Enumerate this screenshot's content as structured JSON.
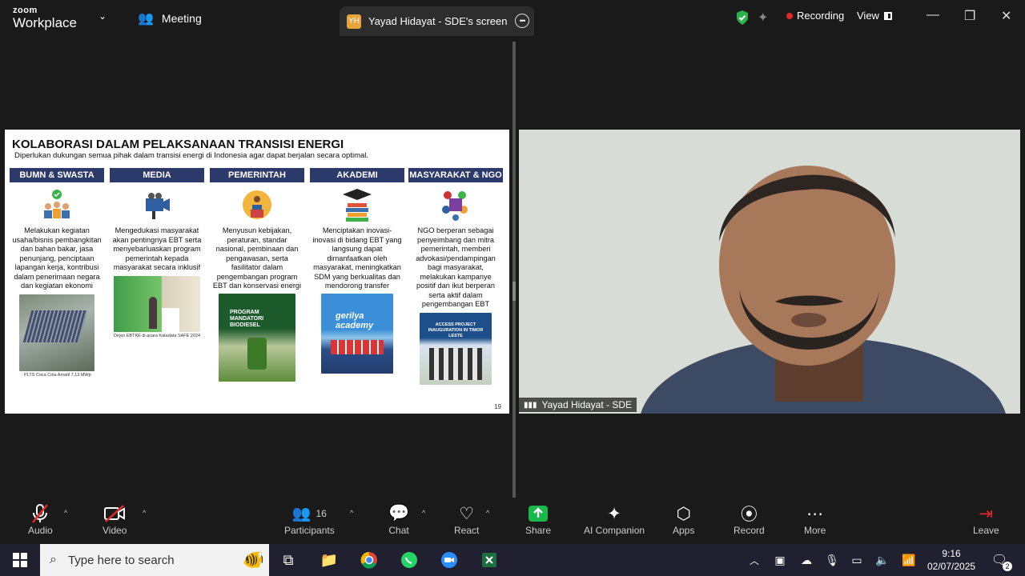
{
  "app": {
    "logo_top": "zoom",
    "logo_bottom": "Workplace",
    "meeting_label": "Meeting"
  },
  "share_tab": {
    "initials": "YH",
    "label": "Yayad Hidayat - SDE's screen"
  },
  "top_right": {
    "recording": "Recording",
    "view": "View"
  },
  "slide": {
    "title": "KOLABORASI DALAM PELAKSANAAN TRANSISI ENERGI",
    "subtitle": "Diperlukan dukungan semua pihak dalam transisi energi di Indonesia agar dapat berjalan secara optimal.",
    "page": "19",
    "columns": [
      {
        "head": "BUMN & SWASTA",
        "icon": "people-check-icon",
        "text": "Melakukan kegiatan usaha/bisnis pembangkitan dan bahan bakar, jasa penunjang, penciptaan lapangan kerja, kontribusi dalam penerimaan negara dan kegiatan ekonomi",
        "caption": "PLTS Coca Cola Amatil 7,13 MWp"
      },
      {
        "head": "MEDIA",
        "icon": "camera-icon",
        "text": "Mengedukasi masyarakat akan pentingnya EBT serta menyebarluaskan program pemerintah kepada masyarakat secara inklusif",
        "caption": "Dirjen EBTKE di acara Katadata SAFE 2024"
      },
      {
        "head": "PEMERINTAH",
        "icon": "podium-icon",
        "text": "Menyusun kebijakan, peraturan, standar nasional, pembinaan dan pengawasan, serta fasilitator dalam pengembangan program EBT dan konservasi energi",
        "caption": "",
        "img_text": "PROGRAM MANDATORI BIODIESEL"
      },
      {
        "head": "AKADEMI",
        "icon": "graduation-icon",
        "text": "Menciptakan inovasi-inovasi di bidang EBT yang langsung dapat dimanfaatkan oleh masyarakat, meningkatkan SDM yang berkualitas dan mendorong transfer",
        "caption": "",
        "img_text": "gerilya academy"
      },
      {
        "head": "MASYARAKAT & NGO",
        "icon": "puzzle-icon",
        "text": "NGO berperan sebagai penyeimbang dan mitra pemerintah, memberi advokasi/pendampingan bagi masyarakat, melakukan kampanye positif dan ikut berperan serta aktif dalam pengembangan EBT",
        "caption": "",
        "img_text": "ACCESS PROJECT INAUGURATION IN TIMOR LESTE"
      }
    ]
  },
  "video": {
    "name": "Yayad Hidayat - SDE"
  },
  "toolbar": {
    "audio": "Audio",
    "video": "Video",
    "participants": "Participants",
    "participants_count": "16",
    "chat": "Chat",
    "react": "React",
    "share": "Share",
    "ai": "AI Companion",
    "apps": "Apps",
    "record": "Record",
    "more": "More",
    "leave": "Leave"
  },
  "taskbar": {
    "search_placeholder": "Type here to search",
    "time": "9:16",
    "date": "02/07/2025",
    "notif_count": "2"
  }
}
